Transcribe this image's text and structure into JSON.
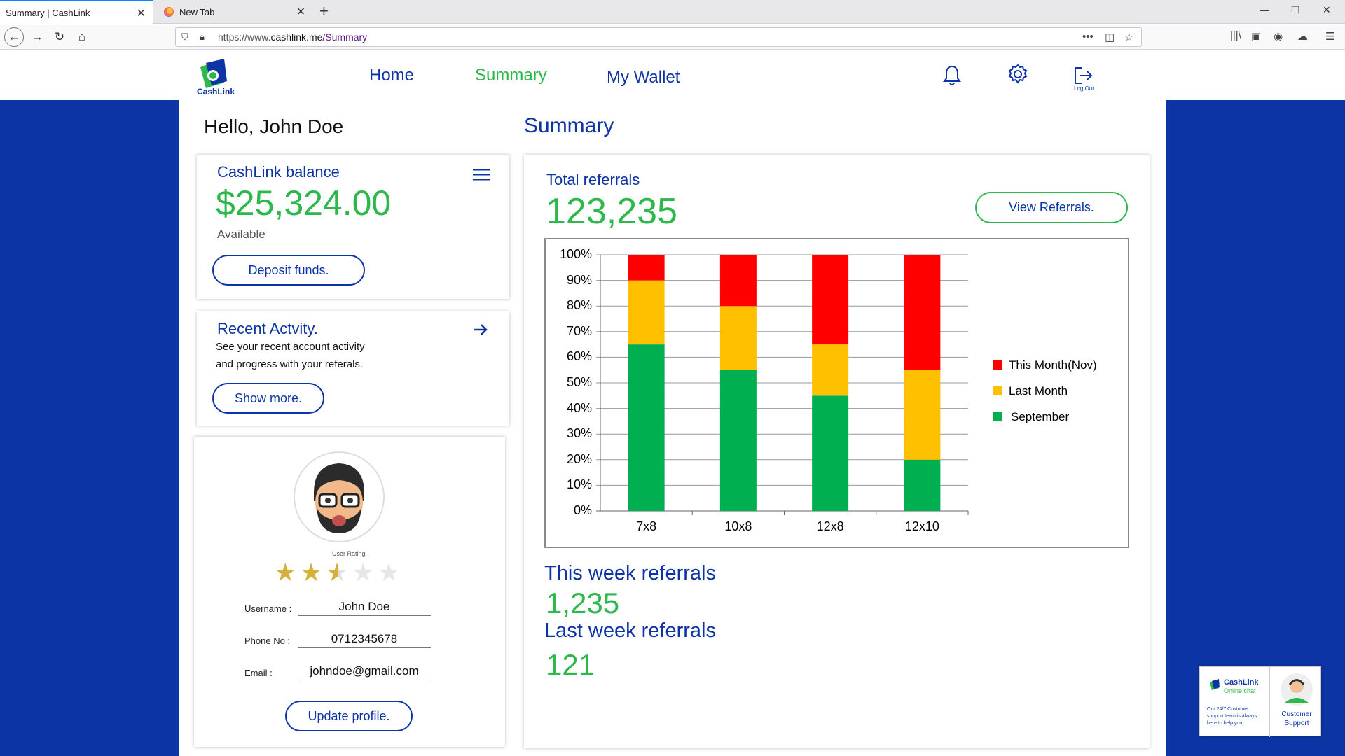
{
  "browser": {
    "tabs": [
      {
        "title": "Summary | CashLink",
        "active": true
      },
      {
        "title": "New Tab",
        "active": false
      }
    ],
    "url": {
      "prefix": "https://www.",
      "host": "cashlink.me",
      "path": "/Summary"
    }
  },
  "header": {
    "logo_text": "CashLink",
    "nav": {
      "home": "Home",
      "summary": "Summary",
      "wallet": "My Wallet"
    },
    "logout_label": "Log Out"
  },
  "greeting": "Hello, John Doe",
  "balance_card": {
    "title": "CashLink balance",
    "amount": "$25,324.00",
    "status": "Available",
    "button": "Deposit funds."
  },
  "activity_card": {
    "title": "Recent Actvity.",
    "line1": "See your recent account activity",
    "line2": "and progress with your referals.",
    "button": "Show more."
  },
  "profile": {
    "rating_label": "User Rating.",
    "rating": 2.5,
    "rating_max": 5,
    "username_label": "Username :",
    "username": "John Doe",
    "phone_label": "Phone No :",
    "phone": "0712345678",
    "email_label": "Email :",
    "email": "johndoe@gmail.com",
    "button": "Update profile."
  },
  "summary": {
    "heading": "Summary",
    "total_label": "Total referrals",
    "total_value": "123,235",
    "view_button": "View Referrals.",
    "week_label": "This week referrals",
    "week_value": "1,235",
    "last_week_label": "Last week referrals",
    "last_week_value": "121"
  },
  "chat_widget": {
    "brand": "CashLink",
    "title": "Online chat",
    "text": "Our 24/7 Customer support team is always here to help you",
    "support_line1": "Customer",
    "support_line2": "Support"
  },
  "chart_data": {
    "type": "bar",
    "stacked": true,
    "categories": [
      "7x8",
      "10x8",
      "12x8",
      "12x10"
    ],
    "y_ticks": [
      "0%",
      "10%",
      "20%",
      "30%",
      "40%",
      "50%",
      "60%",
      "70%",
      "80%",
      "90%",
      "100%"
    ],
    "ylim": [
      0,
      100
    ],
    "grid": true,
    "legend_position": "right",
    "series": [
      {
        "name": "September",
        "color": "#00b050",
        "values": [
          65,
          55,
          45,
          20
        ]
      },
      {
        "name": "Last Month",
        "color": "#ffc000",
        "values": [
          25,
          25,
          20,
          35
        ]
      },
      {
        "name": "This Month(Nov)",
        "color": "#ff0000",
        "values": [
          10,
          20,
          35,
          45
        ]
      }
    ],
    "legend_order": [
      "This Month(Nov)",
      "Last Month",
      "September"
    ]
  },
  "colors": {
    "brand_blue": "#0d34a5",
    "brand_green": "#2db84b",
    "star_gold": "#d4b13b"
  }
}
